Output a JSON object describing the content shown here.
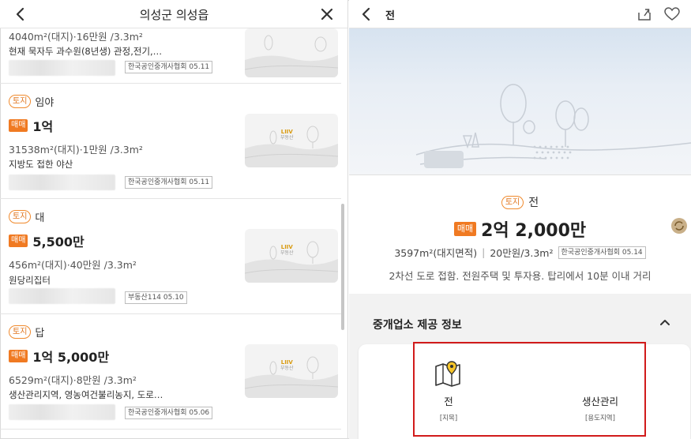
{
  "left_header": {
    "title": "의성군 의성읍"
  },
  "listings": [
    {
      "area": "4040m²(대지)·16만원 /3.3m²",
      "desc": "현재 묵자두 과수원(8년생) 관정,전기,…",
      "agency": "한국공인중개사협회 05.11"
    },
    {
      "tag": "토지",
      "type": "임야",
      "sale": "매매",
      "price": "1억",
      "area": "31538m²(대지)·1만원 /3.3m²",
      "desc": "지방도 접한 야산",
      "agency": "한국공인중개사협회 05.11"
    },
    {
      "tag": "토지",
      "type": "대",
      "sale": "매매",
      "price": "5,500만",
      "area": "456m²(대지)·40만원 /3.3m²",
      "desc": "원당리집터",
      "agency": "부동산114 05.10"
    },
    {
      "tag": "토지",
      "type": "답",
      "sale": "매매",
      "price": "1억 5,000만",
      "area": "6529m²(대지)·8만원 /3.3m²",
      "desc": "생산관리지역, 영농여건불리농지, 도로…",
      "agency": "한국공인중개사협회 05.06"
    }
  ],
  "thumb_brand": {
    "logo": "LIIV",
    "sub": "부동산"
  },
  "right_header": {
    "title": "전"
  },
  "detail": {
    "tag": "토지",
    "type": "전",
    "sale": "매매",
    "price": "2억 2,000만",
    "area": "3597m²(대지면적)",
    "sep": "|",
    "unit_price": "20만원/3.3m²",
    "agency": "한국공인중개사협회 05.14",
    "desc": "2차선 도로 접함. 전원주택 및 투자용. 탑리에서 10분 이내 거리"
  },
  "broker_section": {
    "title": "중개업소 제공 정보",
    "items": [
      {
        "value": "전",
        "label": "[지목]"
      },
      {
        "value": "생산관리",
        "label": "[용도지역]"
      }
    ]
  },
  "colors": {
    "accent": "#f07a22",
    "highlight": "#d11b1b"
  },
  "icons": [
    "back-icon",
    "close-icon",
    "share-icon",
    "heart-icon",
    "chevron-up-icon",
    "map-pin-icon",
    "refresh-icon"
  ]
}
